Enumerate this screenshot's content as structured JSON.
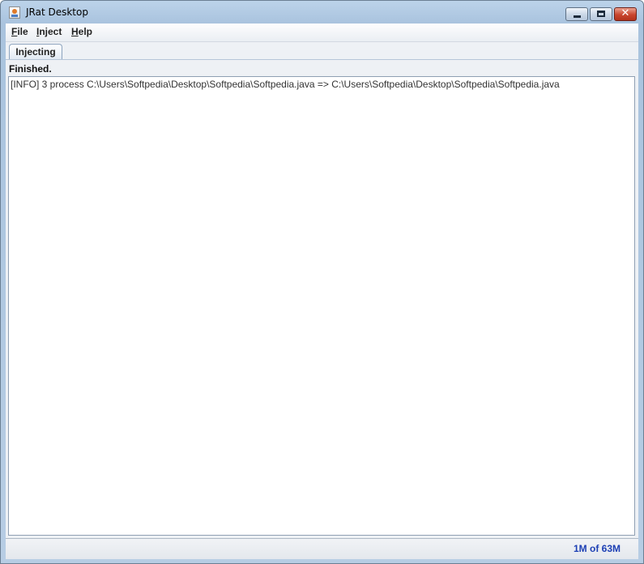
{
  "window": {
    "title": "JRat Desktop",
    "icon": "java-cup-icon"
  },
  "menubar": {
    "items": [
      {
        "label": "File",
        "mnemonic": "F",
        "rest": "ile"
      },
      {
        "label": "Inject",
        "mnemonic": "I",
        "rest": "nject"
      },
      {
        "label": "Help",
        "mnemonic": "H",
        "rest": "elp"
      }
    ]
  },
  "tabs": [
    {
      "label": "Injecting",
      "selected": true
    }
  ],
  "panel": {
    "status": "Finished.",
    "log_lines": [
      "[INFO] 3 process C:\\Users\\Softpedia\\Desktop\\Softpedia\\Softpedia.java => C:\\Users\\Softpedia\\Desktop\\Softpedia\\Softpedia.java"
    ]
  },
  "statusbar": {
    "memory": "1M of 63M"
  },
  "colors": {
    "memory_text": "#1c3fb4",
    "title_gradient_top": "#bcd3ea",
    "close_button": "#c9452e"
  }
}
